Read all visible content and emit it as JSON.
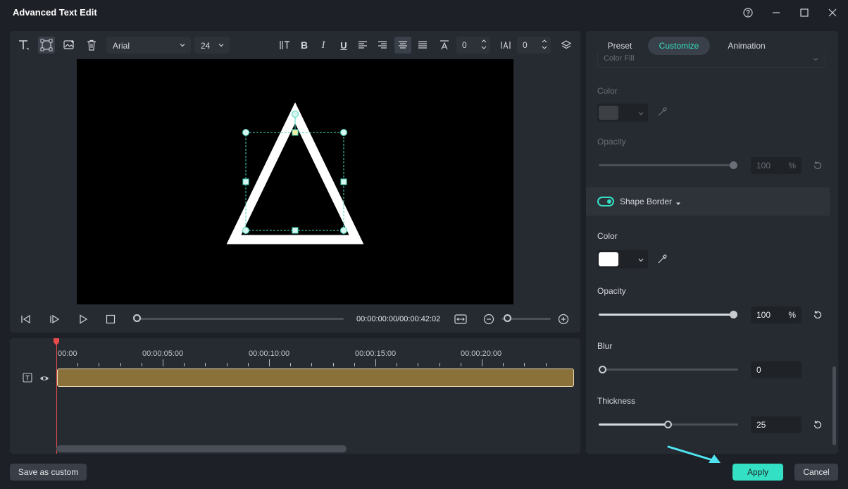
{
  "window": {
    "title": "Advanced Text Edit"
  },
  "toolbar": {
    "font_family": "Arial",
    "font_size": "24",
    "char_spacing": "0",
    "line_spacing": "0"
  },
  "player": {
    "timecode": "00:00:00:00/00:00:42:02",
    "progress": 0.0
  },
  "timeline": {
    "ruler": [
      "00:00",
      "00:00:05:00",
      "00:00:10:00",
      "00:00:15:00",
      "00:00:20:00"
    ]
  },
  "panel": {
    "tabs": [
      {
        "label": "Preset"
      },
      {
        "label": "Customize"
      },
      {
        "label": "Animation"
      }
    ],
    "fill_type": "Color Fill",
    "fill": {
      "color_label": "Color",
      "color": "#3c3f44",
      "opacity_label": "Opacity",
      "opacity_value": "100",
      "opacity_unit": "%"
    },
    "border_section": "Shape Border",
    "border": {
      "color_label": "Color",
      "color": "#ffffff",
      "opacity_label": "Opacity",
      "opacity_value": "100",
      "opacity_unit": "%",
      "blur_label": "Blur",
      "blur_value": "0",
      "thickness_label": "Thickness",
      "thickness_value": "25"
    }
  },
  "footer": {
    "save_custom": "Save as custom",
    "apply": "Apply",
    "cancel": "Cancel"
  },
  "colors": {
    "accent": "#34e0c4",
    "clip": "#8a713a",
    "playhead": "#e84b4b"
  }
}
